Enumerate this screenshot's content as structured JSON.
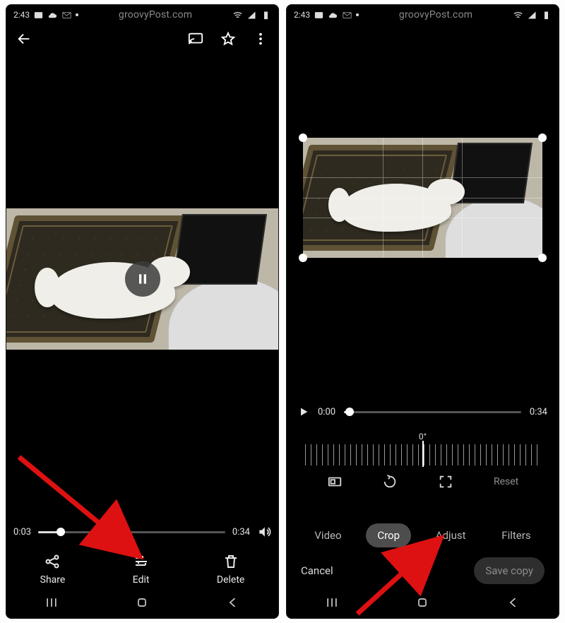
{
  "status": {
    "time": "2:43",
    "watermark": "groovyPost.com"
  },
  "left": {
    "playback": {
      "pos_text": "0:03",
      "dur_text": "0:34",
      "pct": 12
    },
    "actions": [
      {
        "label": "Share",
        "name": "share-button"
      },
      {
        "label": "Edit",
        "name": "edit-button"
      },
      {
        "label": "Delete",
        "name": "delete-button"
      }
    ]
  },
  "right": {
    "playback": {
      "pos_text": "0:00",
      "dur_text": "0:34",
      "pct": 3
    },
    "rotation_label": "0°",
    "tools": {
      "reset_label": "Reset"
    },
    "tabs": [
      {
        "label": "Video",
        "name": "tab-video",
        "active": false
      },
      {
        "label": "Crop",
        "name": "tab-crop",
        "active": true
      },
      {
        "label": "Adjust",
        "name": "tab-adjust",
        "active": false
      },
      {
        "label": "Filters",
        "name": "tab-filters",
        "active": false
      }
    ],
    "cancel_label": "Cancel",
    "save_label": "Save copy"
  }
}
